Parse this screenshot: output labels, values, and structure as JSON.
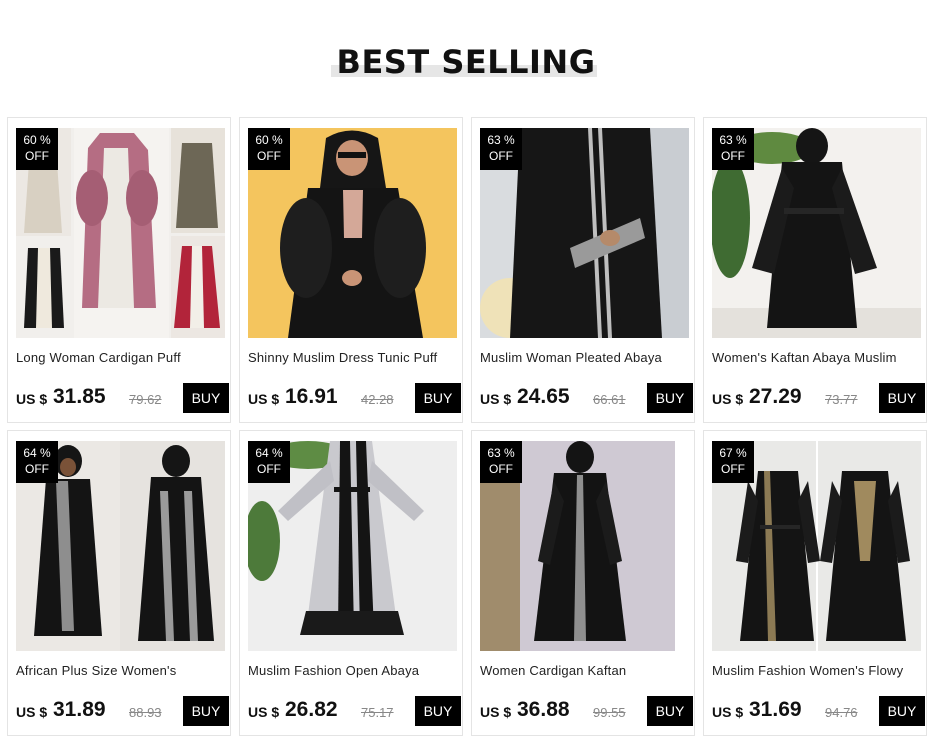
{
  "heading": "BEST SELLING",
  "colors": {
    "badge": "#000000",
    "buy_button": "#000000",
    "old_price": "#888888",
    "heading_bar": "#e6e6e6"
  },
  "products": [
    {
      "discount": "60 %",
      "off": "OFF",
      "title": "Long Woman Cardigan Puff",
      "currency": "US $",
      "price": "31.85",
      "old_price": "79.62",
      "buy_label": "BUY",
      "image": "pink-satin-abaya-collage"
    },
    {
      "discount": "60 %",
      "off": "OFF",
      "title": "Shinny Muslim Dress Tunic Puff",
      "currency": "US $",
      "price": "16.91",
      "old_price": "42.28",
      "buy_label": "BUY",
      "image": "black-puff-abaya-yellow-wall"
    },
    {
      "discount": "63 %",
      "off": "OFF",
      "title": "Muslim Woman Pleated Abaya",
      "currency": "US $",
      "price": "24.65",
      "old_price": "66.61",
      "buy_label": "BUY",
      "image": "black-abaya-embroidered-trim"
    },
    {
      "discount": "63 %",
      "off": "OFF",
      "title": "Women's Kaftan Abaya Muslim",
      "currency": "US $",
      "price": "27.29",
      "old_price": "73.77",
      "buy_label": "BUY",
      "image": "black-kaftan-belted"
    },
    {
      "discount": "64 %",
      "off": "OFF",
      "title": "African Plus Size Women's",
      "currency": "US $",
      "price": "31.89",
      "old_price": "88.93",
      "buy_label": "BUY",
      "image": "black-embroidered-abaya-front-back"
    },
    {
      "discount": "64 %",
      "off": "OFF",
      "title": "Muslim Fashion Open Abaya",
      "currency": "US $",
      "price": "26.82",
      "old_price": "75.17",
      "buy_label": "BUY",
      "image": "grey-lace-open-abaya"
    },
    {
      "discount": "63 %",
      "off": "OFF",
      "title": "Women Cardigan Kaftan",
      "currency": "US $",
      "price": "36.88",
      "old_price": "99.55",
      "buy_label": "BUY",
      "image": "black-cardigan-kaftan"
    },
    {
      "discount": "67 %",
      "off": "OFF",
      "title": "Muslim Fashion Women's Flowy",
      "currency": "US $",
      "price": "31.69",
      "old_price": "94.76",
      "buy_label": "BUY",
      "image": "black-gold-abaya-mannequin"
    }
  ]
}
